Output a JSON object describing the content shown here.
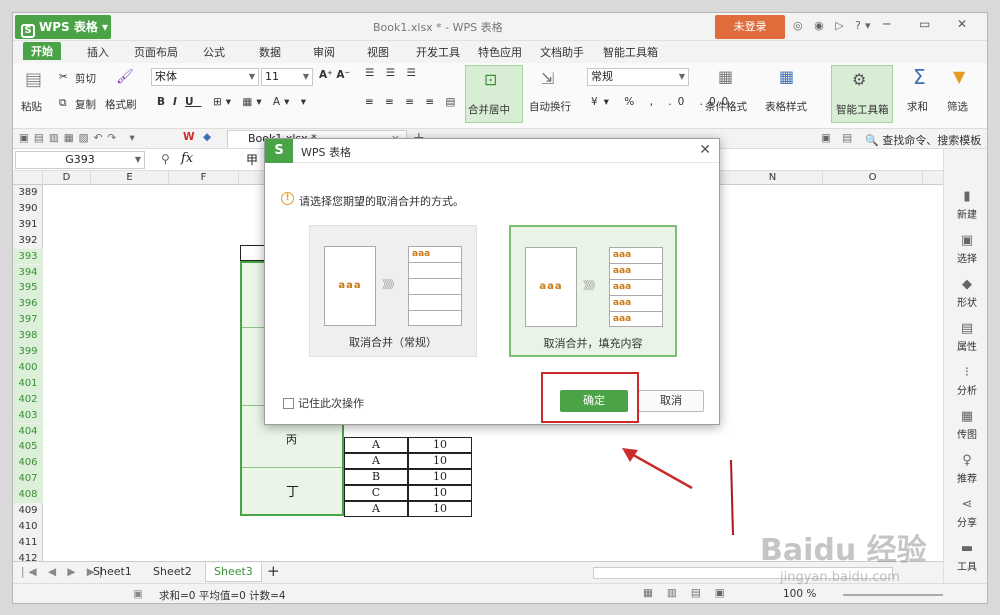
{
  "title_bar": {
    "app_name": "WPS 表格",
    "doc_title": "Book1.xlsx * - WPS 表格",
    "login": "未登录"
  },
  "menu_tabs": [
    "开始",
    "插入",
    "页面布局",
    "公式",
    "数据",
    "审阅",
    "视图",
    "开发工具",
    "特色应用",
    "文档助手",
    "智能工具箱"
  ],
  "ribbon": {
    "paste": "粘贴",
    "cut": "剪切",
    "copy": "复制",
    "format_painter": "格式刷",
    "font_name": "宋体",
    "font_size": "11",
    "merge_center": "合并居中",
    "auto_wrap": "自动换行",
    "number_format": "常规",
    "cond_format": "条件格式",
    "table_style": "表格样式",
    "smart_toolbox": "智能工具箱",
    "sum": "求和",
    "filter": "筛选"
  },
  "file_tab": "Book1.xlsx *",
  "search_cmd": "查找命令、搜索模板",
  "name_box": "G393",
  "formula_value": "甲",
  "columns": [
    "D",
    "E",
    "F",
    "N",
    "O"
  ],
  "rows": [
    "389",
    "390",
    "391",
    "392",
    "393",
    "394",
    "395",
    "396",
    "397",
    "398",
    "399",
    "400",
    "401",
    "402",
    "403",
    "404",
    "405",
    "406",
    "407",
    "408",
    "409",
    "410",
    "411",
    "412"
  ],
  "cells": {
    "merged_label_1": "丙",
    "merged_label_2": "丁",
    "col_i": [
      "A",
      "A",
      "B",
      "C",
      "A"
    ],
    "col_j": [
      "10",
      "10",
      "10",
      "10",
      "10"
    ]
  },
  "side_panel": [
    "新建",
    "选择",
    "形状",
    "属性",
    "分析",
    "传图",
    "推荐",
    "分享",
    "工具"
  ],
  "sheets": [
    "Sheet1",
    "Sheet2",
    "Sheet3"
  ],
  "status": "求和=0  平均值=0  计数=4",
  "zoom": "100 %",
  "dialog": {
    "title": "WPS 表格",
    "message": "请选择您期望的取消合并的方式。",
    "option1_caption": "取消合并（常规）",
    "option2_caption": "取消合并，填充内容",
    "sample_text": "aaa",
    "remember": "记住此次操作",
    "ok": "确定",
    "cancel": "取消"
  },
  "watermark": {
    "brand": "Baidu 经验",
    "url": "jingyan.baidu.com"
  },
  "colors": {
    "accent_green": "#4aa447",
    "login_orange": "#e06b3b",
    "annotation_red": "#cc2b2b"
  }
}
